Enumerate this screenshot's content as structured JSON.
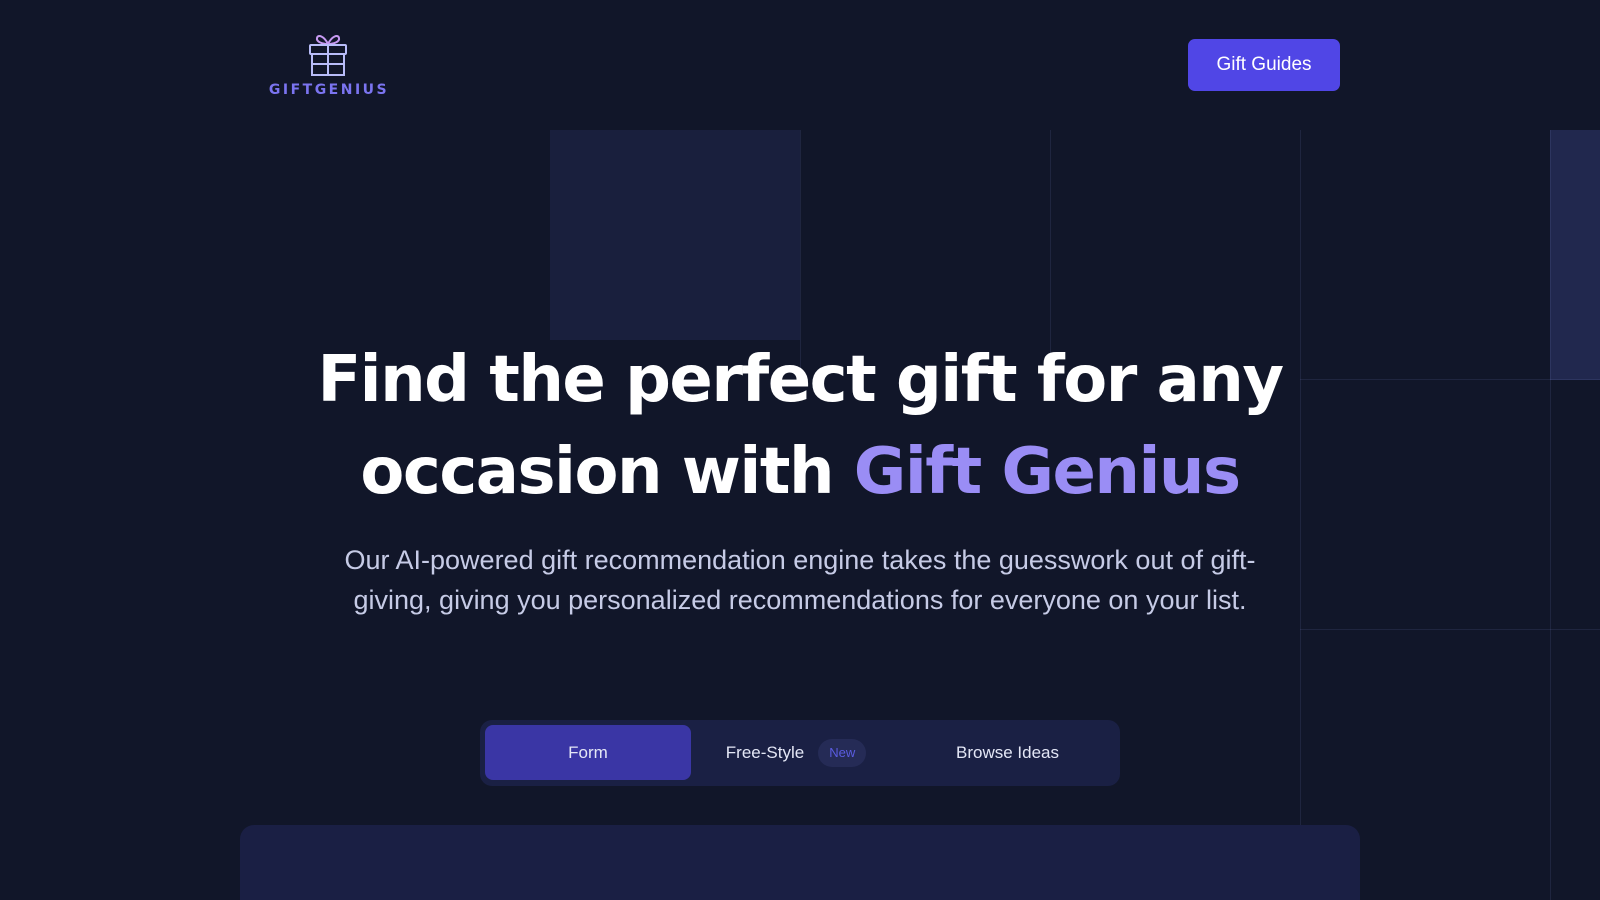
{
  "header": {
    "logo_text": "GIFTGENIUS",
    "logo_icon": "gift-icon",
    "guides_button_label": "Gift Guides"
  },
  "hero": {
    "title_part1": "Find the perfect gift for any",
    "title_part2": "occasion with ",
    "title_accent": "Gift Genius",
    "subtitle": "Our AI-powered gift recommendation engine takes the guesswork out of gift-giving, giving you personalized recommendations for everyone on your list."
  },
  "tabs": {
    "form_label": "Form",
    "freestyle_label": "Free-Style",
    "freestyle_badge": "New",
    "browse_label": "Browse Ideas",
    "active": "Form"
  },
  "colors": {
    "background": "#111629",
    "accent": "#5046e6",
    "title_accent": "#9a8df5",
    "active_tab": "#3a36a5"
  }
}
